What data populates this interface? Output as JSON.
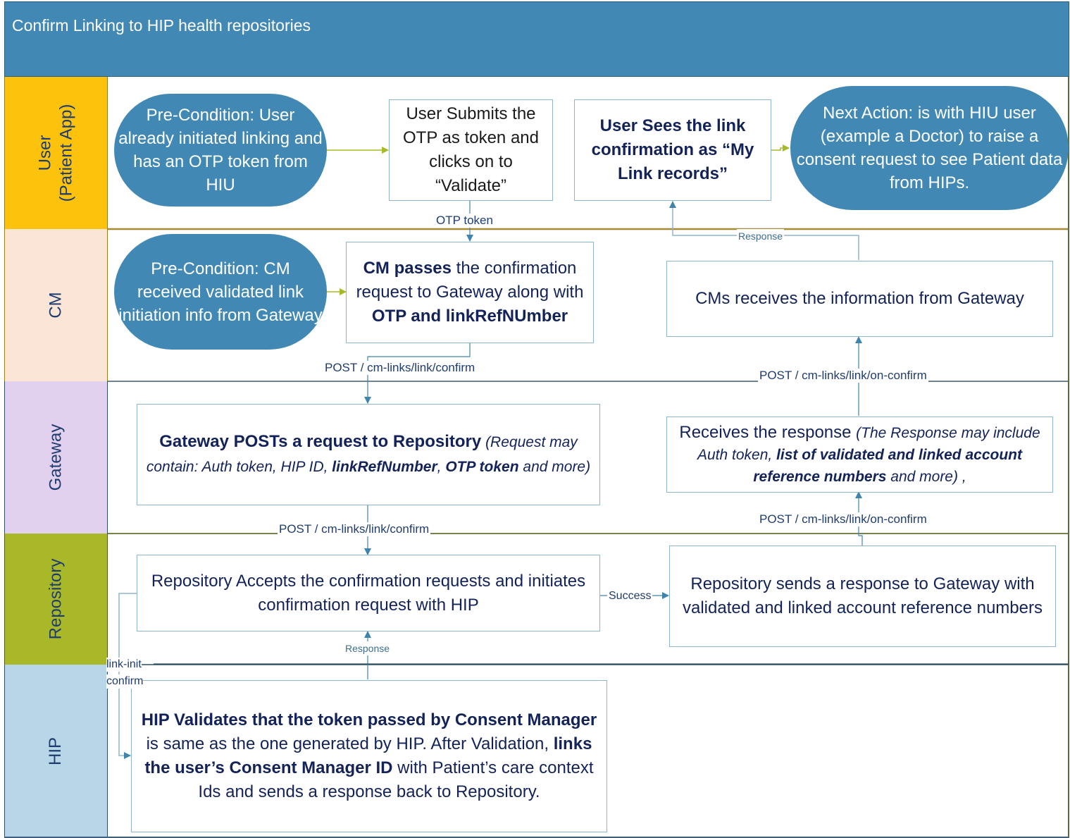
{
  "header": {
    "title": "Confirm Linking to HIP health repositories"
  },
  "colors": {
    "header": "#4189b4",
    "user_lane": "#fdc20b",
    "cm_lane": "#fbe5d6",
    "gateway_lane": "#e2d0ef",
    "repository_lane": "#a8b828",
    "hip_lane": "#b8d6e8",
    "oval": "#4189b4",
    "box_border": "#8db5cd",
    "text_dark_blue": "#13235a"
  },
  "lanes": [
    {
      "id": "user",
      "label_line1": "User",
      "label_line2": "(Patient App)"
    },
    {
      "id": "cm",
      "label_line1": "CM"
    },
    {
      "id": "gateway",
      "label_line1": "Gateway"
    },
    {
      "id": "repository",
      "label_line1": "Repository"
    },
    {
      "id": "hip",
      "label_line1": "HIP"
    }
  ],
  "nodes": {
    "user_precondition": "Pre-Condition: User already initiated linking and has an OTP token from HIU",
    "user_submits": "User Submits the OTP as token and clicks on to “Validate”",
    "user_sees": "User Sees the link confirmation as “My Link records”",
    "next_action": "Next Action: is with HIU user (example a Doctor) to raise a consent request to see Patient data from HIPs.",
    "cm_precondition": "Pre-Condition: CM received validated link initiation info from Gateway",
    "cm_passes": {
      "bold1": "CM passes",
      "text1": " the confirmation request to Gateway along with ",
      "bold2": "OTP and linkRefNUmber"
    },
    "cm_receives": "CMs receives the information from Gateway",
    "gateway_posts": {
      "bold1": "Gateway POSTs a request to Repository",
      "italic1": " (Request may contain: Auth token, HIP ID, ",
      "bolditalic1": "linkRefNumber",
      "italic2": ", ",
      "bolditalic2": "OTP token",
      "italic3": " and more)"
    },
    "gateway_receives": {
      "text1": "Receives the response ",
      "italic1": "(The Response may include Auth token, ",
      "bolditalic1": "list of validated and linked account reference numbers",
      "italic2": " and more) ,"
    },
    "repo_accepts": "Repository Accepts the confirmation requests and initiates confirmation request with HIP",
    "repo_sends": "Repository sends a response to Gateway with validated and linked account reference numbers",
    "hip_validates": {
      "bold1": "HIP Validates that the token passed by Consent Manager",
      "text1": " is same as the one generated by HIP. After Validation, ",
      "bold2": "links the user’s Consent Manager ID",
      "text2": " with Patient’s care context Ids and sends a response back to Repository."
    }
  },
  "edge_labels": {
    "otp_token": "OTP token",
    "response_top": "Response",
    "cm_to_gateway": "POST / cm-links/link/confirm",
    "gateway_to_cm": "POST / cm-links/link/on-confirm",
    "gateway_to_repo": "POST / cm-links/link/confirm",
    "repo_to_gateway": "POST / cm-links/link/on-confirm",
    "success": "Success",
    "hip_response": "Response",
    "link_init": "link-init",
    "confirm": "confirm"
  }
}
